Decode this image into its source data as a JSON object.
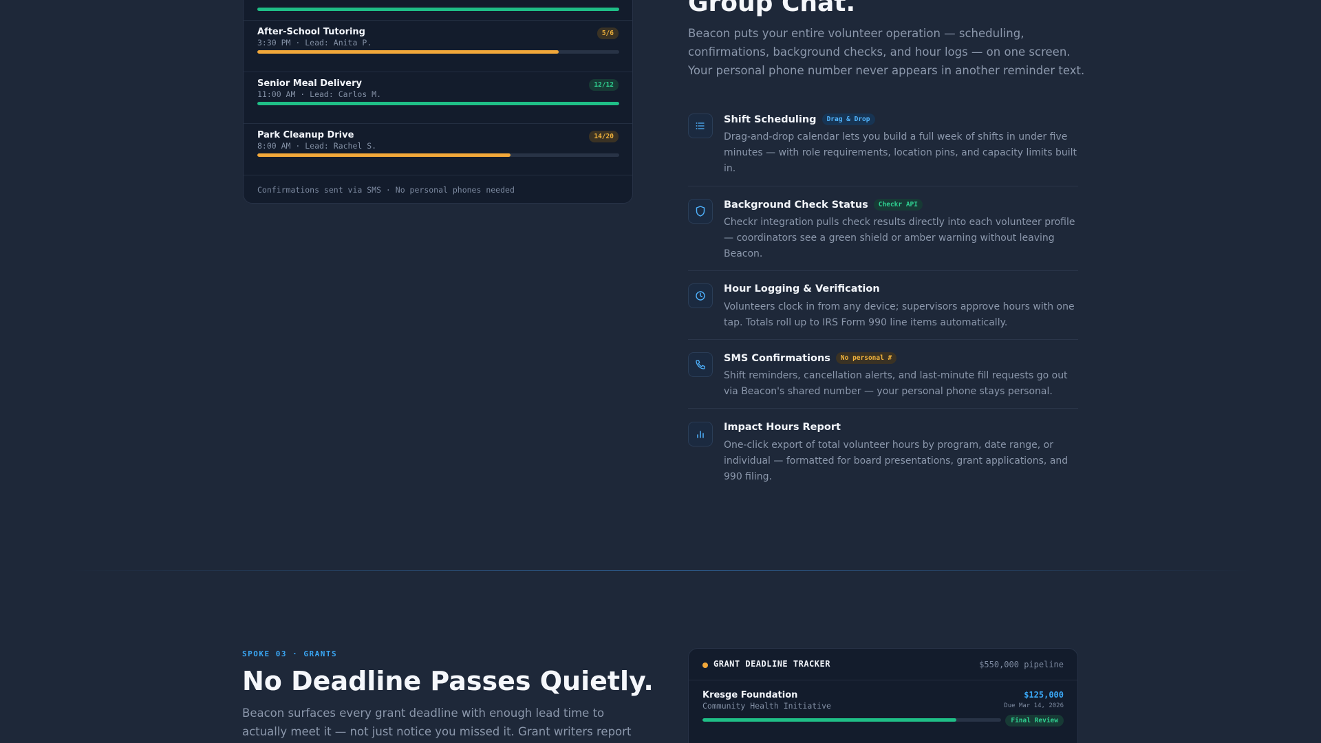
{
  "shift_card": {
    "shifts": [
      {
        "name": "After-School Tutoring",
        "meta": "3:30 PM · Lead: Anita P.",
        "badge": "5/6",
        "status": "amber",
        "filled": 5,
        "capacity": 6
      },
      {
        "name": "Senior Meal Delivery",
        "meta": "11:00 AM · Lead: Carlos M.",
        "badge": "12/12",
        "status": "green",
        "filled": 12,
        "capacity": 12
      },
      {
        "name": "Park Cleanup Drive",
        "meta": "8:00 AM · Lead: Rachel S.",
        "badge": "14/20",
        "status": "amber",
        "filled": 14,
        "capacity": 20
      }
    ],
    "footer": "Confirmations sent via SMS · No personal phones needed"
  },
  "features_section": {
    "heading": "Group Chat.",
    "intro": "Beacon puts your entire volunteer operation — scheduling, confirmations, background checks, and hour logs — on one screen. Your personal phone number never appears in another reminder text.",
    "features": [
      {
        "icon": "list-icon",
        "title": "Shift Scheduling",
        "tag": "Drag & Drop",
        "tag_color": "blue",
        "desc": "Drag-and-drop calendar lets you build a full week of shifts in under five minutes — with role requirements, location pins, and capacity limits built in."
      },
      {
        "icon": "shield-icon",
        "title": "Background Check Status",
        "tag": "Checkr API",
        "tag_color": "green",
        "desc": "Checkr integration pulls check results directly into each volunteer profile — coordinators see a green shield or amber warning without leaving Beacon."
      },
      {
        "icon": "clock-icon",
        "title": "Hour Logging & Verification",
        "tag": "",
        "tag_color": "",
        "desc": "Volunteers clock in from any device; supervisors approve hours with one tap. Totals roll up to IRS Form 990 line items automatically."
      },
      {
        "icon": "phone-icon",
        "title": "SMS Confirmations",
        "tag": "No personal #",
        "tag_color": "amber",
        "desc": "Shift reminders, cancellation alerts, and last-minute fill requests go out via Beacon's shared number — your personal phone stays personal."
      },
      {
        "icon": "bar-chart-icon",
        "title": "Impact Hours Report",
        "tag": "",
        "tag_color": "",
        "desc": "One-click export of total volunteer hours by program, date range, or individual — formatted for board presentations, grant applications, and 990 filing."
      }
    ]
  },
  "grants_section": {
    "eyebrow": "SPOKE 03 · GRANTS",
    "title": "No Deadline Passes Quietly.",
    "desc": "Beacon surfaces every grant deadline with enough lead time to actually meet it — not just notice you missed it. Grant writers report",
    "tracker": {
      "title": "GRANT DEADLINE TRACKER",
      "pipeline": "$550,000 pipeline",
      "grants": [
        {
          "name": "Kresge Foundation",
          "program": "Community Health Initiative",
          "amount": "$125,000",
          "due": "Due Mar 14, 2026",
          "status": "Final Review",
          "progress": 0.85
        }
      ]
    }
  },
  "colors": {
    "background": "#1e2839",
    "card": "#131c2c",
    "accent_blue": "#3aa7f5",
    "green": "#1fbf87",
    "amber": "#f2a83a"
  }
}
